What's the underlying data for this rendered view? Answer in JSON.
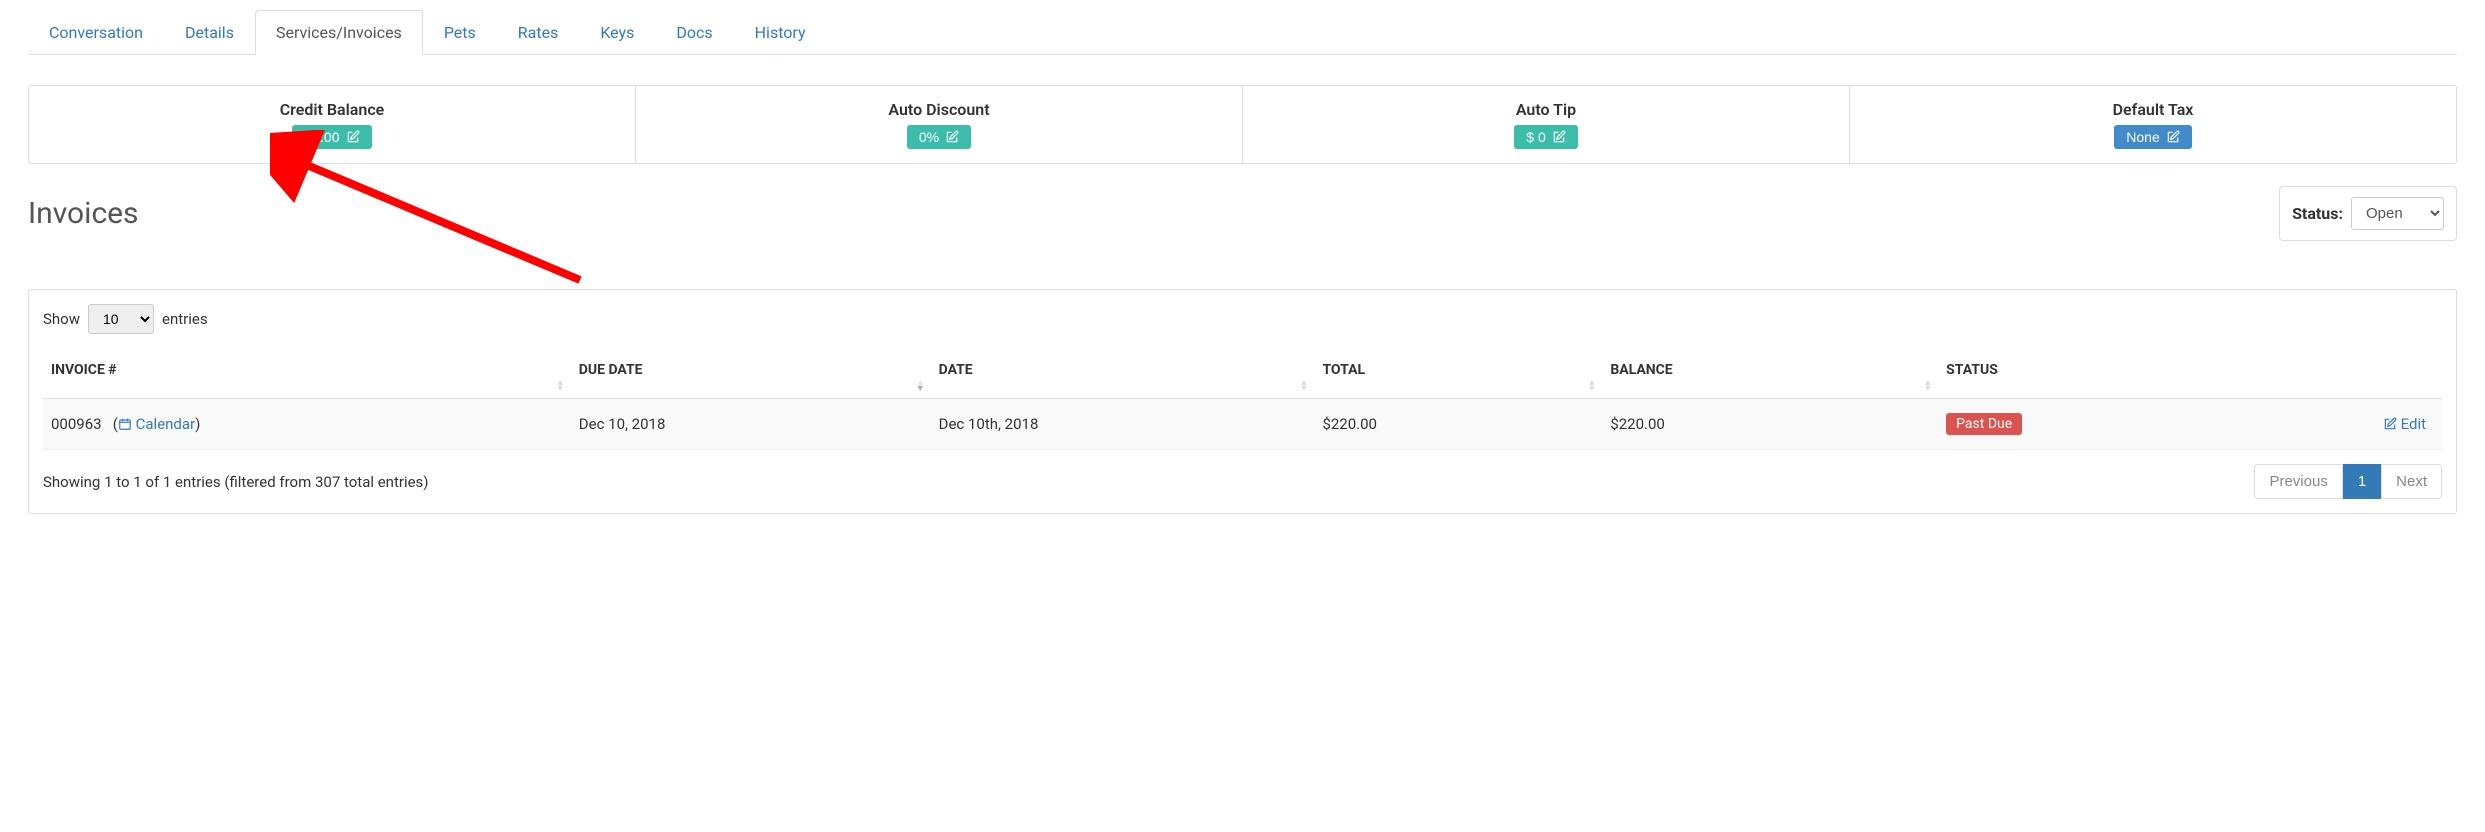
{
  "tabs": [
    {
      "label": "Conversation",
      "active": false
    },
    {
      "label": "Details",
      "active": false
    },
    {
      "label": "Services/Invoices",
      "active": true
    },
    {
      "label": "Pets",
      "active": false
    },
    {
      "label": "Rates",
      "active": false
    },
    {
      "label": "Keys",
      "active": false
    },
    {
      "label": "Docs",
      "active": false
    },
    {
      "label": "History",
      "active": false
    }
  ],
  "cards": {
    "credit_balance": {
      "title": "Credit Balance",
      "value": "$0.00"
    },
    "auto_discount": {
      "title": "Auto Discount",
      "value": "0%"
    },
    "auto_tip": {
      "title": "Auto Tip",
      "value": "$ 0"
    },
    "default_tax": {
      "title": "Default Tax",
      "value": "None"
    }
  },
  "invoices_section": {
    "heading": "Invoices",
    "status_label": "Status:",
    "status_selected": "Open",
    "show_label_pre": "Show",
    "show_label_post": "entries",
    "show_value": "10",
    "columns": {
      "invoice_no": "INVOICE #",
      "due_date": "DUE DATE",
      "date": "DATE",
      "total": "TOTAL",
      "balance": "BALANCE",
      "status": "STATUS"
    },
    "rows": [
      {
        "invoice_no": "000963",
        "calendar_label": "Calendar",
        "due_date": "Dec 10, 2018",
        "date": "Dec 10th, 2018",
        "total": "$220.00",
        "balance": "$220.00",
        "status": "Past Due",
        "edit_label": "Edit"
      }
    ],
    "footer_info": "Showing 1 to 1 of 1 entries (filtered from 307 total entries)",
    "pagination": {
      "previous": "Previous",
      "pages": [
        "1"
      ],
      "next": "Next",
      "current": "1"
    }
  }
}
